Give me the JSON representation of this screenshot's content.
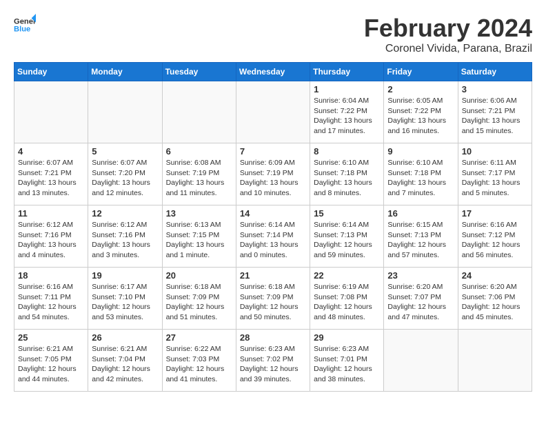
{
  "logo": {
    "line1": "General",
    "line2": "Blue"
  },
  "title": "February 2024",
  "location": "Coronel Vivida, Parana, Brazil",
  "weekdays": [
    "Sunday",
    "Monday",
    "Tuesday",
    "Wednesday",
    "Thursday",
    "Friday",
    "Saturday"
  ],
  "weeks": [
    [
      {
        "day": "",
        "sunrise": "",
        "sunset": "",
        "daylight": ""
      },
      {
        "day": "",
        "sunrise": "",
        "sunset": "",
        "daylight": ""
      },
      {
        "day": "",
        "sunrise": "",
        "sunset": "",
        "daylight": ""
      },
      {
        "day": "",
        "sunrise": "",
        "sunset": "",
        "daylight": ""
      },
      {
        "day": "1",
        "sunrise": "Sunrise: 6:04 AM",
        "sunset": "Sunset: 7:22 PM",
        "daylight": "Daylight: 13 hours and 17 minutes."
      },
      {
        "day": "2",
        "sunrise": "Sunrise: 6:05 AM",
        "sunset": "Sunset: 7:22 PM",
        "daylight": "Daylight: 13 hours and 16 minutes."
      },
      {
        "day": "3",
        "sunrise": "Sunrise: 6:06 AM",
        "sunset": "Sunset: 7:21 PM",
        "daylight": "Daylight: 13 hours and 15 minutes."
      }
    ],
    [
      {
        "day": "4",
        "sunrise": "Sunrise: 6:07 AM",
        "sunset": "Sunset: 7:21 PM",
        "daylight": "Daylight: 13 hours and 13 minutes."
      },
      {
        "day": "5",
        "sunrise": "Sunrise: 6:07 AM",
        "sunset": "Sunset: 7:20 PM",
        "daylight": "Daylight: 13 hours and 12 minutes."
      },
      {
        "day": "6",
        "sunrise": "Sunrise: 6:08 AM",
        "sunset": "Sunset: 7:19 PM",
        "daylight": "Daylight: 13 hours and 11 minutes."
      },
      {
        "day": "7",
        "sunrise": "Sunrise: 6:09 AM",
        "sunset": "Sunset: 7:19 PM",
        "daylight": "Daylight: 13 hours and 10 minutes."
      },
      {
        "day": "8",
        "sunrise": "Sunrise: 6:10 AM",
        "sunset": "Sunset: 7:18 PM",
        "daylight": "Daylight: 13 hours and 8 minutes."
      },
      {
        "day": "9",
        "sunrise": "Sunrise: 6:10 AM",
        "sunset": "Sunset: 7:18 PM",
        "daylight": "Daylight: 13 hours and 7 minutes."
      },
      {
        "day": "10",
        "sunrise": "Sunrise: 6:11 AM",
        "sunset": "Sunset: 7:17 PM",
        "daylight": "Daylight: 13 hours and 5 minutes."
      }
    ],
    [
      {
        "day": "11",
        "sunrise": "Sunrise: 6:12 AM",
        "sunset": "Sunset: 7:16 PM",
        "daylight": "Daylight: 13 hours and 4 minutes."
      },
      {
        "day": "12",
        "sunrise": "Sunrise: 6:12 AM",
        "sunset": "Sunset: 7:16 PM",
        "daylight": "Daylight: 13 hours and 3 minutes."
      },
      {
        "day": "13",
        "sunrise": "Sunrise: 6:13 AM",
        "sunset": "Sunset: 7:15 PM",
        "daylight": "Daylight: 13 hours and 1 minute."
      },
      {
        "day": "14",
        "sunrise": "Sunrise: 6:14 AM",
        "sunset": "Sunset: 7:14 PM",
        "daylight": "Daylight: 13 hours and 0 minutes."
      },
      {
        "day": "15",
        "sunrise": "Sunrise: 6:14 AM",
        "sunset": "Sunset: 7:13 PM",
        "daylight": "Daylight: 12 hours and 59 minutes."
      },
      {
        "day": "16",
        "sunrise": "Sunrise: 6:15 AM",
        "sunset": "Sunset: 7:13 PM",
        "daylight": "Daylight: 12 hours and 57 minutes."
      },
      {
        "day": "17",
        "sunrise": "Sunrise: 6:16 AM",
        "sunset": "Sunset: 7:12 PM",
        "daylight": "Daylight: 12 hours and 56 minutes."
      }
    ],
    [
      {
        "day": "18",
        "sunrise": "Sunrise: 6:16 AM",
        "sunset": "Sunset: 7:11 PM",
        "daylight": "Daylight: 12 hours and 54 minutes."
      },
      {
        "day": "19",
        "sunrise": "Sunrise: 6:17 AM",
        "sunset": "Sunset: 7:10 PM",
        "daylight": "Daylight: 12 hours and 53 minutes."
      },
      {
        "day": "20",
        "sunrise": "Sunrise: 6:18 AM",
        "sunset": "Sunset: 7:09 PM",
        "daylight": "Daylight: 12 hours and 51 minutes."
      },
      {
        "day": "21",
        "sunrise": "Sunrise: 6:18 AM",
        "sunset": "Sunset: 7:09 PM",
        "daylight": "Daylight: 12 hours and 50 minutes."
      },
      {
        "day": "22",
        "sunrise": "Sunrise: 6:19 AM",
        "sunset": "Sunset: 7:08 PM",
        "daylight": "Daylight: 12 hours and 48 minutes."
      },
      {
        "day": "23",
        "sunrise": "Sunrise: 6:20 AM",
        "sunset": "Sunset: 7:07 PM",
        "daylight": "Daylight: 12 hours and 47 minutes."
      },
      {
        "day": "24",
        "sunrise": "Sunrise: 6:20 AM",
        "sunset": "Sunset: 7:06 PM",
        "daylight": "Daylight: 12 hours and 45 minutes."
      }
    ],
    [
      {
        "day": "25",
        "sunrise": "Sunrise: 6:21 AM",
        "sunset": "Sunset: 7:05 PM",
        "daylight": "Daylight: 12 hours and 44 minutes."
      },
      {
        "day": "26",
        "sunrise": "Sunrise: 6:21 AM",
        "sunset": "Sunset: 7:04 PM",
        "daylight": "Daylight: 12 hours and 42 minutes."
      },
      {
        "day": "27",
        "sunrise": "Sunrise: 6:22 AM",
        "sunset": "Sunset: 7:03 PM",
        "daylight": "Daylight: 12 hours and 41 minutes."
      },
      {
        "day": "28",
        "sunrise": "Sunrise: 6:23 AM",
        "sunset": "Sunset: 7:02 PM",
        "daylight": "Daylight: 12 hours and 39 minutes."
      },
      {
        "day": "29",
        "sunrise": "Sunrise: 6:23 AM",
        "sunset": "Sunset: 7:01 PM",
        "daylight": "Daylight: 12 hours and 38 minutes."
      },
      {
        "day": "",
        "sunrise": "",
        "sunset": "",
        "daylight": ""
      },
      {
        "day": "",
        "sunrise": "",
        "sunset": "",
        "daylight": ""
      }
    ]
  ]
}
